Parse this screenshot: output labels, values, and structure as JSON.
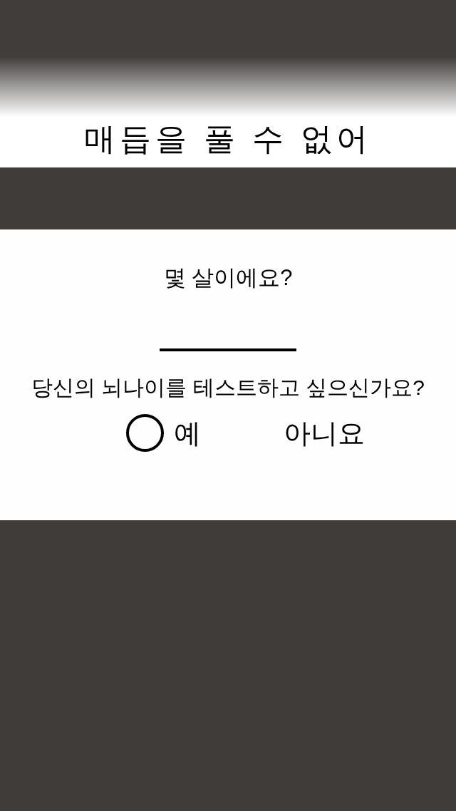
{
  "title": "매듭을 풀 수 없어",
  "question": "몇 살이에요?",
  "prompt": "당신의 뇌나이를 테스트하고 싶으신가요?",
  "options": [
    {
      "label": "예",
      "selected": true
    },
    {
      "label": "아니요",
      "selected": false
    }
  ]
}
